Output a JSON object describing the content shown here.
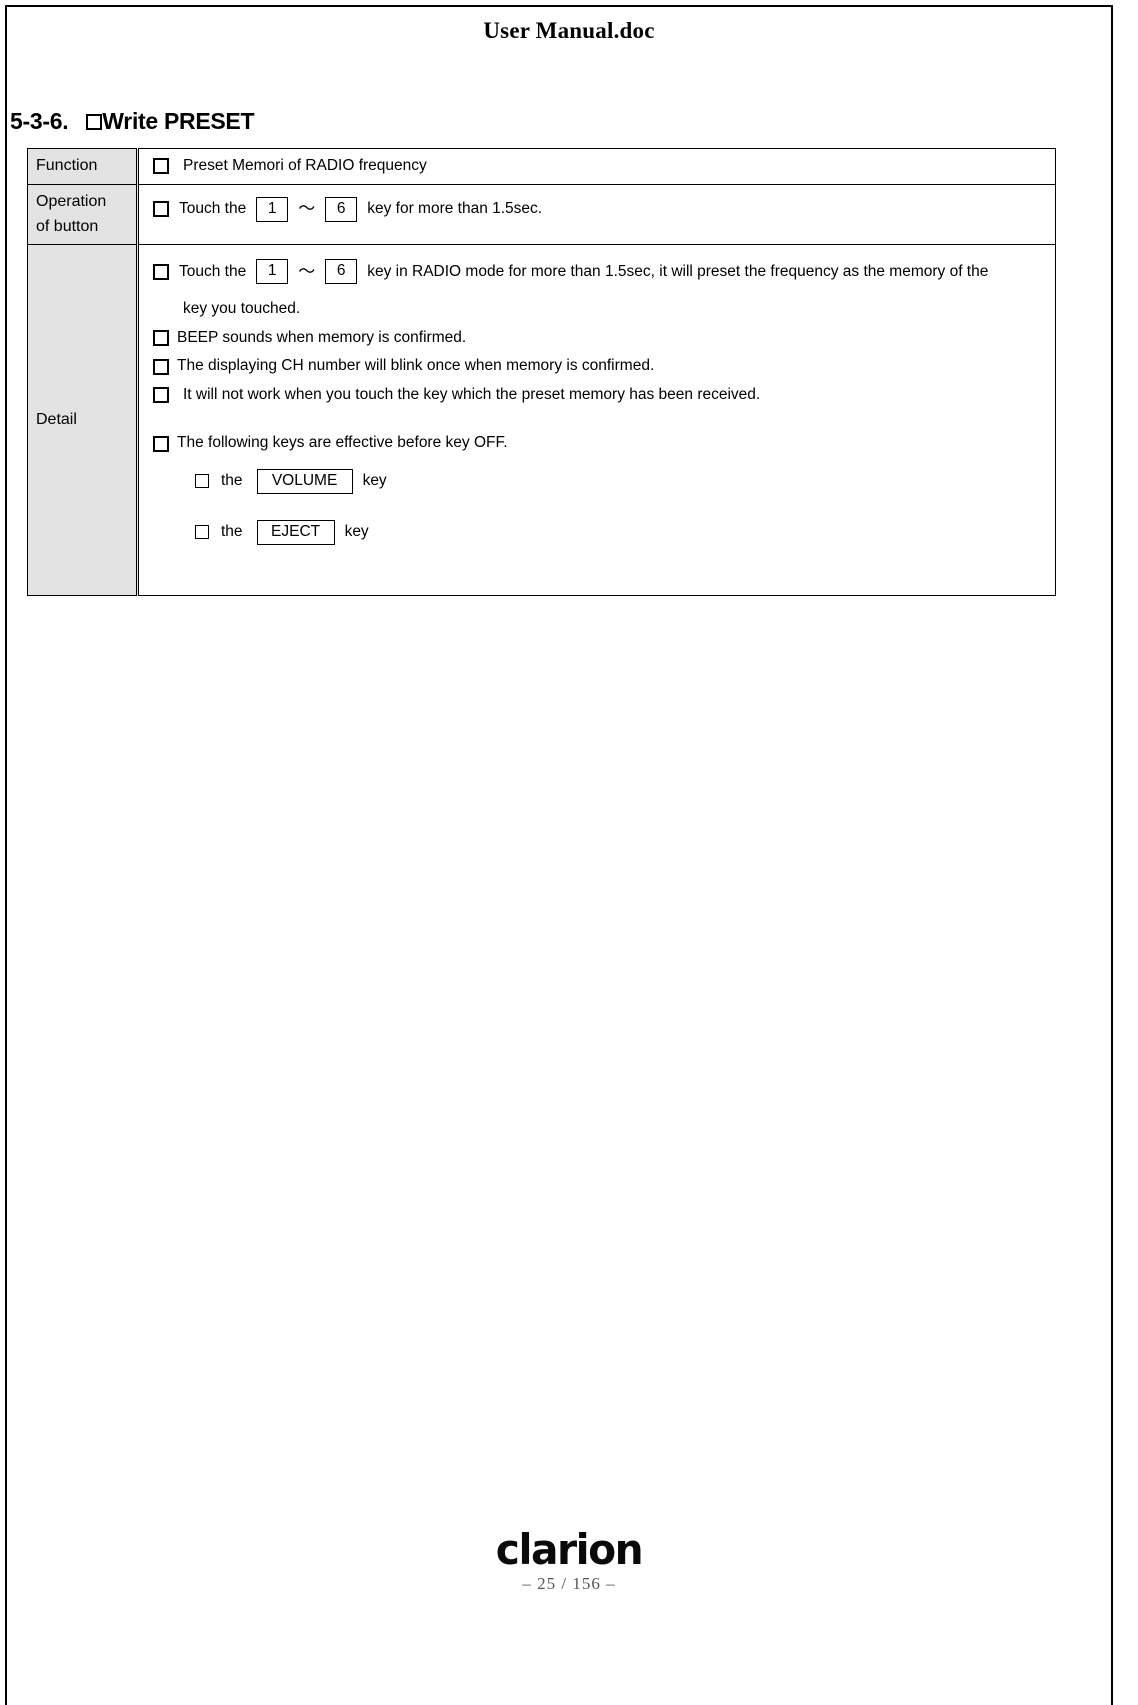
{
  "document": {
    "header_title": "User Manual.doc"
  },
  "section": {
    "number": "5-3-6.",
    "checkbox_icon": "empty-checkbox",
    "title": "Write PRESET"
  },
  "table": {
    "rows": [
      {
        "label": "Function",
        "lines": [
          {
            "checkbox": "empty-checkbox",
            "text": "Preset Memori of RADIO frequency"
          }
        ]
      },
      {
        "label_line1": "Operation",
        "label_line2": "of button",
        "operation": {
          "checkbox": "empty-checkbox",
          "prefix": "Touch the",
          "key_from": "1",
          "range_symbol": "～",
          "key_to": "6",
          "suffix": "key for more than 1.5sec."
        }
      },
      {
        "label": "Detail",
        "detail": {
          "item1": {
            "checkbox": "empty-checkbox",
            "prefix": "Touch the",
            "key_from": "1",
            "range_symbol": "～",
            "key_to": "6",
            "suffix": "key in RADIO mode for more than 1.5sec, it will preset the frequency as the memory of the",
            "continuation": "key you touched."
          },
          "item2": {
            "checkbox": "empty-checkbox",
            "text": "BEEP sounds when memory is confirmed."
          },
          "item3": {
            "checkbox": "empty-checkbox",
            "text": "The displaying CH number will blink once when memory is confirmed."
          },
          "item4": {
            "checkbox": "empty-checkbox",
            "text": "It will not work when you touch the key which the preset memory has been received."
          },
          "item5": {
            "checkbox": "empty-checkbox",
            "text": "The following keys are effective before key OFF."
          },
          "sub1": {
            "checkbox": "empty-checkbox",
            "the": "the",
            "key_label": "VOLUME",
            "key_word": "key"
          },
          "sub2": {
            "checkbox": "empty-checkbox",
            "the": "the",
            "key_label": "EJECT",
            "key_word": "key"
          }
        }
      }
    ]
  },
  "footer": {
    "brand": "clarion",
    "page_number": "– 25 / 156 –"
  },
  "colors": {
    "label_background": "#e3e3e3",
    "border": "#000000",
    "page_number_text": "#555555"
  }
}
